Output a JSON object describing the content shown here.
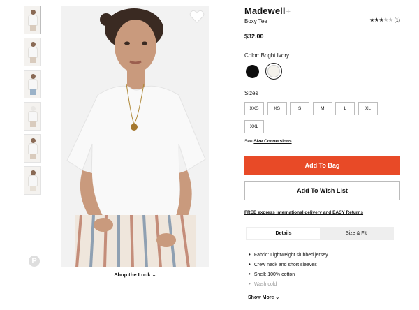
{
  "brand": {
    "name": "Madewell",
    "plus": "+"
  },
  "product": {
    "name": "Boxy Tee",
    "price": "$32.00"
  },
  "rating": {
    "stars": 3,
    "out_of": 5,
    "count": "(1)"
  },
  "color": {
    "label": "Color: Bright Ivory",
    "options": [
      "black",
      "bright-ivory"
    ],
    "selected": "bright-ivory"
  },
  "sizes": {
    "label": "Sizes",
    "options": [
      "XXS",
      "XS",
      "S",
      "M",
      "L",
      "XL",
      "XXL"
    ]
  },
  "size_conversions": {
    "prefix": "See ",
    "link": "Size Conversions"
  },
  "buttons": {
    "add_to_bag": "Add To Bag",
    "add_to_wishlist": "Add To Wish List"
  },
  "shipping": "FREE express international delivery and EASY Returns",
  "tabs": [
    {
      "label": "Details",
      "active": true
    },
    {
      "label": "Size & Fit",
      "active": false
    }
  ],
  "details": [
    "Fabric: Lightweight slubbed jersey",
    "Crew neck and short sleeves",
    "Shell: 100% cotton",
    "Wash cold"
  ],
  "show_more": "Show More",
  "shop_the_look": "Shop the Look",
  "pinterest_icon": "P",
  "colors": {
    "accent": "#e84a27"
  }
}
